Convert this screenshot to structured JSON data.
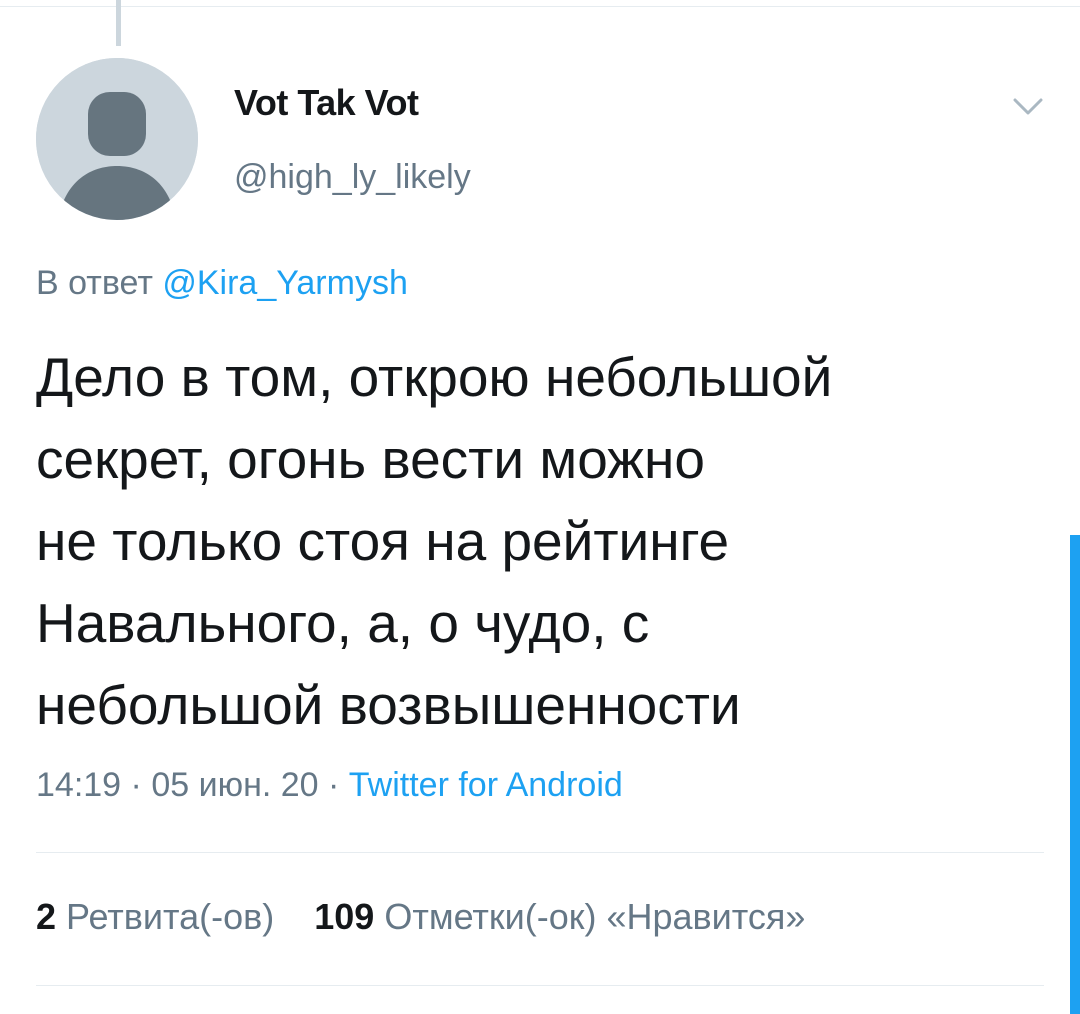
{
  "author": {
    "name": "Vot Tak Vot",
    "handle": "@high_ly_likely",
    "avatar_icon": "default-user-avatar-icon"
  },
  "reply": {
    "prefix": "В ответ",
    "mention": "@Kira_Yarmysh"
  },
  "tweet": {
    "text": "Дело в том, открою небольшой\nсекрет, огонь вести можно\nне только стоя на рейтинге\nНавального, а, о чудо, с\nнебольшой возвышенности"
  },
  "meta": {
    "time": "14:19",
    "separator1": " · ",
    "date": "05 июн. 20",
    "separator2": " · ",
    "source": "Twitter for Android"
  },
  "stats": {
    "retweets_count": "2",
    "retweets_label": "Ретвита(-ов)",
    "likes_count": "109",
    "likes_label": "Отметки(-ок) «Нравится»"
  },
  "icons": {
    "caret": "chevron-down-icon"
  },
  "colors": {
    "accent": "#1da1f2",
    "secondary_text": "#657786",
    "primary_text": "#14171a",
    "avatar_bg": "#ccd6dd",
    "avatar_fg": "#66757f"
  }
}
